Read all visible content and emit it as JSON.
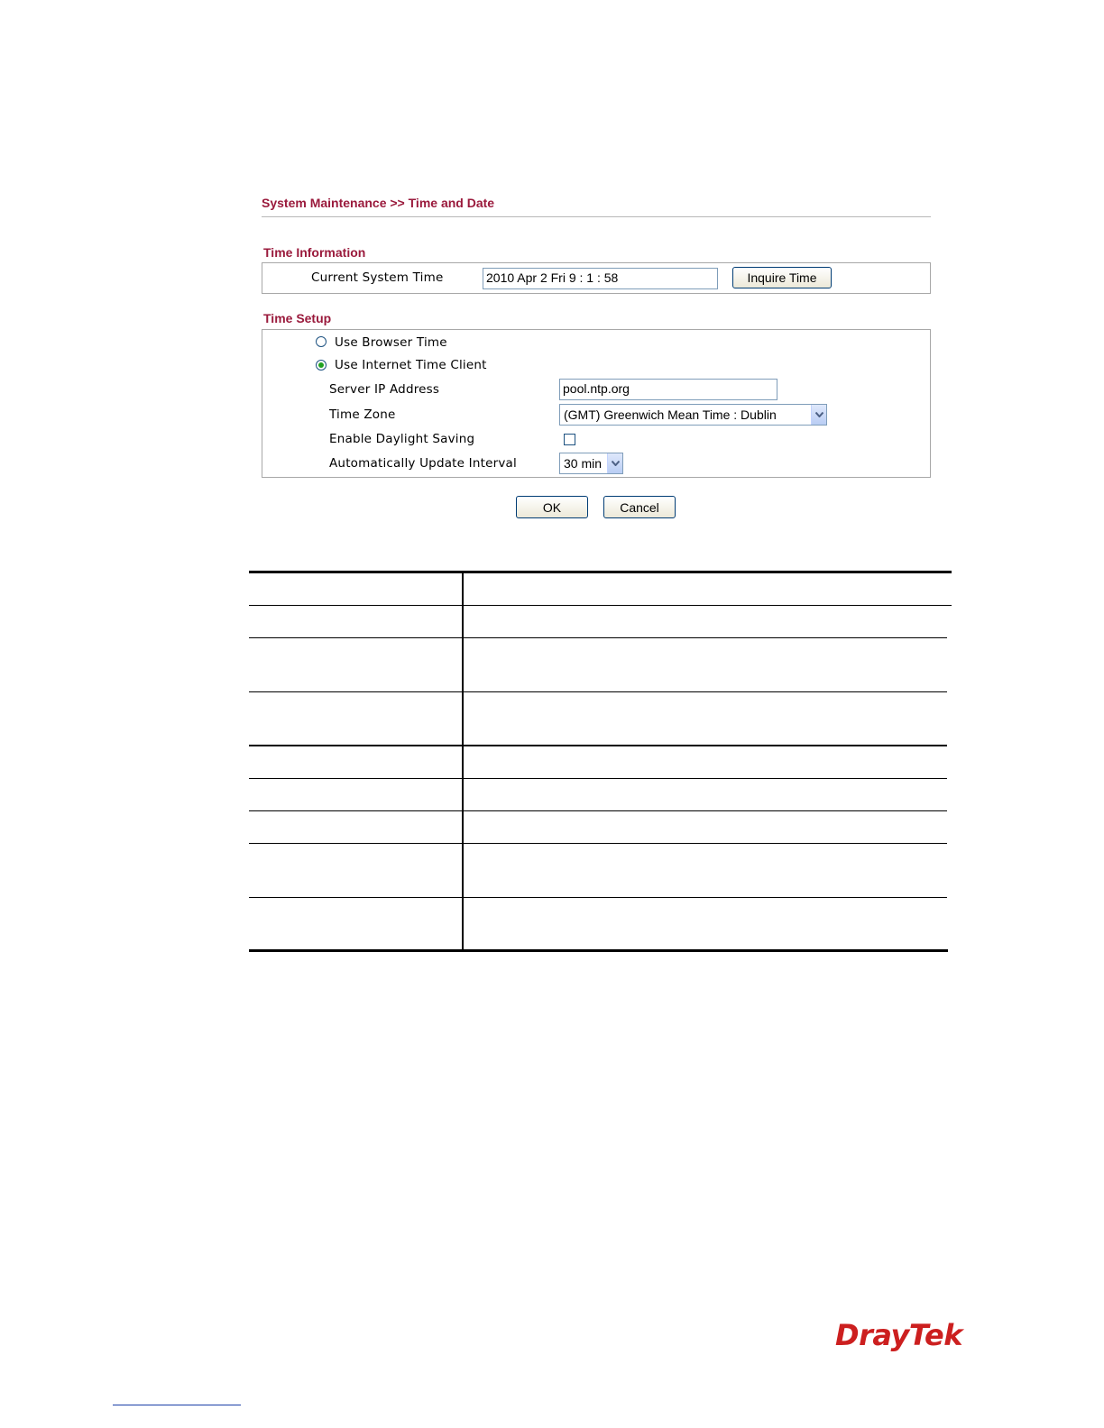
{
  "breadcrumb": "System Maintenance >> Time and Date",
  "time_information": {
    "title": "Time Information",
    "current_system_time_label": "Current System Time",
    "current_system_time_value": "2010 Apr 2 Fri 9 : 1 : 58",
    "inquire_button": "Inquire Time"
  },
  "time_setup": {
    "title": "Time Setup",
    "use_browser_time_label": "Use Browser Time",
    "use_browser_time_selected": false,
    "use_internet_time_label": "Use Internet Time Client",
    "use_internet_time_selected": true,
    "server_ip_label": "Server IP Address",
    "server_ip_value": "pool.ntp.org",
    "time_zone_label": "Time Zone",
    "time_zone_value": "(GMT) Greenwich Mean Time : Dublin",
    "daylight_saving_label": "Enable Daylight Saving",
    "daylight_saving_checked": false,
    "update_interval_label": "Automatically Update Interval",
    "update_interval_value": "30 min"
  },
  "buttons": {
    "ok": "OK",
    "cancel": "Cancel"
  },
  "footer": {
    "logo_text": "DrayTek"
  },
  "colors": {
    "heading": "#9a1a3c",
    "logo": "#cc1f1f",
    "selected_radio": "#21a121"
  },
  "icons": {
    "dropdown_arrow": "chevron-down-icon"
  }
}
